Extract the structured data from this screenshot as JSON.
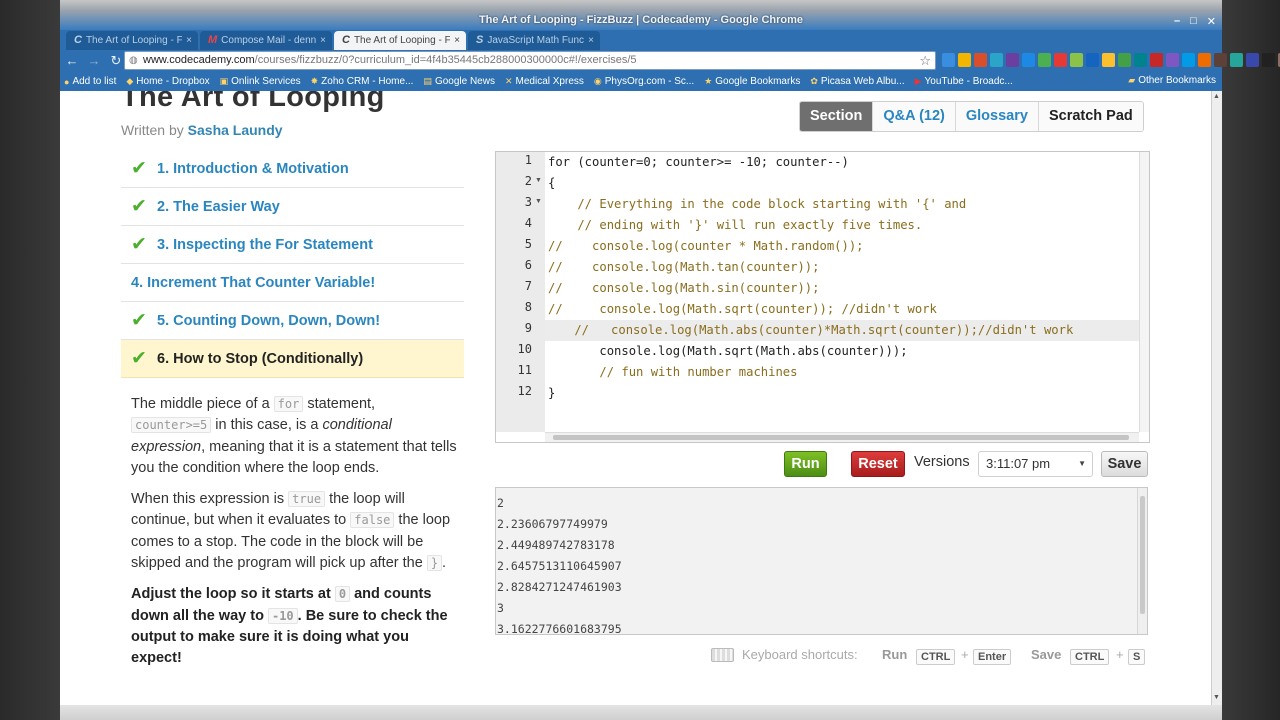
{
  "window": {
    "title": "The Art of Looping - FizzBuzz | Codecademy - Google Chrome",
    "controls": [
      "–",
      "□",
      "✕"
    ]
  },
  "tabs": [
    {
      "favicon": "C",
      "label": "The Art of Looping - Fizz...",
      "active": false
    },
    {
      "favicon": "M",
      "label": "Compose Mail - dennis...",
      "active": false
    },
    {
      "favicon": "C",
      "label": "The Art of Looping - Fizz...",
      "active": true
    },
    {
      "favicon": "S",
      "label": "JavaScript Math Functi...",
      "active": false
    }
  ],
  "address": {
    "host": "www.codecademy.com",
    "path": "/courses/fizzbuzz/0?curriculum_id=4f4b35445cb288000300000c#!/exercises/5"
  },
  "bookmarks": [
    "Add to list",
    "Home - Dropbox",
    "Onlink Services",
    "Zoho CRM - Home...",
    "Google News",
    "Medical Xpress",
    "PhysOrg.com - Sc...",
    "Google Bookmarks",
    "Picasa Web Albu...",
    "YouTube - Broadc..."
  ],
  "other_bookmarks": "Other Bookmarks",
  "lesson": {
    "title": "The Art of Looping",
    "written_by": "Written by",
    "author": "Sasha Laundy"
  },
  "exercises": [
    {
      "label": "1. Introduction & Motivation",
      "done": true,
      "current": false
    },
    {
      "label": "2. The Easier Way",
      "done": true,
      "current": false
    },
    {
      "label": "3. Inspecting the For Statement",
      "done": true,
      "current": false
    },
    {
      "label": "4. Increment That Counter Variable!",
      "done": false,
      "current": false
    },
    {
      "label": "5. Counting Down, Down, Down!",
      "done": true,
      "current": false
    },
    {
      "label": "6. How to Stop (Conditionally)",
      "done": true,
      "current": true
    }
  ],
  "instructions": {
    "p1_a": "The middle piece of a ",
    "p1_code1": "for",
    "p1_b": " statement, ",
    "p1_code2": "counter>=5",
    "p1_c": " in this case, is a ",
    "p1_em": "conditional expression",
    "p1_d": ", meaning that it is a statement that tells you the condition where the loop ends.",
    "p2_a": "When this expression is ",
    "p2_code1": "true",
    "p2_b": " the loop will continue, but when it evaluates to ",
    "p2_code2": "false",
    "p2_c": " the loop comes to a stop. The code in the block will be skipped and the program will pick up after the ",
    "p2_code3": "}",
    "p2_d": ".",
    "p3_a": "Adjust the loop so it starts at ",
    "p3_code1": "0",
    "p3_b": " and counts down all the way to ",
    "p3_code2": "-10",
    "p3_c": ". Be sure to check the output to make sure it is doing what you expect!"
  },
  "panel_tabs": {
    "section": "Section",
    "qa": "Q&A (12)",
    "glossary": "Glossary",
    "scratch": "Scratch Pad"
  },
  "code_lines": [
    "for (counter=0; counter>= -10; counter--)",
    "{",
    "    // Everything in the code block starting with '{' and",
    "    // ending with '}' will run exactly five times.",
    "//    console.log(counter * Math.random());",
    "//    console.log(Math.tan(counter));",
    "//    console.log(Math.sin(counter));",
    "//     console.log(Math.sqrt(counter)); //didn't work",
    "    //   console.log(Math.abs(counter)*Math.sqrt(counter));//didn't work",
    "       console.log(Math.sqrt(Math.abs(counter)));",
    "       // fun with number machines",
    "}"
  ],
  "line_numbers": [
    "1",
    "2",
    "3",
    "4",
    "5",
    "6",
    "7",
    "8",
    "9",
    "10",
    "11",
    "12"
  ],
  "actions": {
    "run": "Run",
    "reset": "Reset",
    "versions_label": "Versions",
    "versions_value": "3:11:07 pm",
    "save": "Save"
  },
  "console_output": [
    "2",
    "2.23606797749979",
    "2.449489742783178",
    "2.6457513110645907",
    "2.8284271247461903",
    "3",
    "3.1622776601683795"
  ],
  "shortcuts": {
    "label": "Keyboard shortcuts:",
    "run": "Run",
    "run_keys": [
      "CTRL",
      "Enter"
    ],
    "save": "Save",
    "save_keys": [
      "CTRL",
      "S"
    ],
    "plus": "+"
  }
}
